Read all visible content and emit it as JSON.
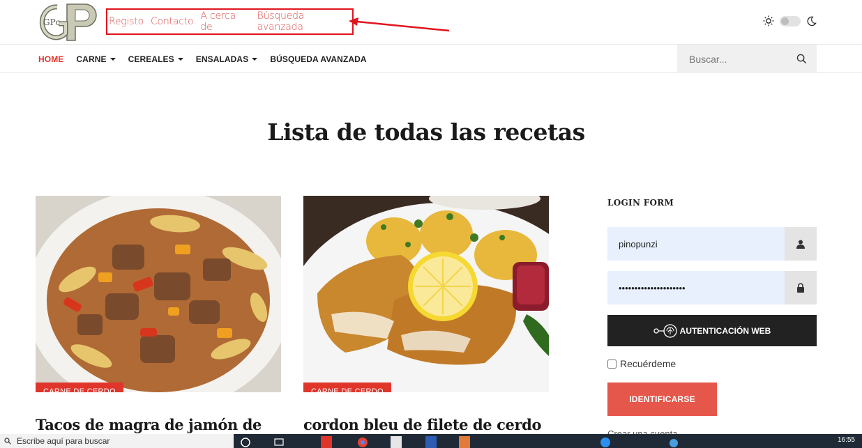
{
  "header": {
    "logo_letters": "GPc",
    "links": [
      "Registo",
      "Contacto",
      "A cerca de",
      "Búsqueda avanzada"
    ]
  },
  "nav": {
    "items": [
      {
        "label": "HOME",
        "active": true,
        "dropdown": false
      },
      {
        "label": "CARNE",
        "active": false,
        "dropdown": true
      },
      {
        "label": "CEREALES",
        "active": false,
        "dropdown": true
      },
      {
        "label": "ENSALADAS",
        "active": false,
        "dropdown": true
      },
      {
        "label": "BÚSQUEDA AVANZADA",
        "active": false,
        "dropdown": false
      }
    ],
    "search_placeholder": "Buscar..."
  },
  "main": {
    "title": "Lista de todas las recetas",
    "cards": [
      {
        "category": "CARNE DE CERDO",
        "title": "Tacos de magra de jamón de"
      },
      {
        "category": "CARNE DE CERDO",
        "title": "cordon bleu de filete de cerdo"
      }
    ]
  },
  "login": {
    "heading": "LOGIN FORM",
    "username": "pinopunzi",
    "password": "•••••••••••••••••••••",
    "webauth_label": "AUTENTICACIÓN WEB",
    "remember_label": "Recuérdeme",
    "submit_label": "IDENTIFICARSE",
    "create_account": "Crear una cuenta"
  },
  "taskbar": {
    "search_text": "Escribe aquí para buscar",
    "clock": "16:55"
  },
  "colors": {
    "accent": "#e0352b",
    "highlight_box": "#e0141e",
    "input_bg": "#e8f0fe"
  }
}
